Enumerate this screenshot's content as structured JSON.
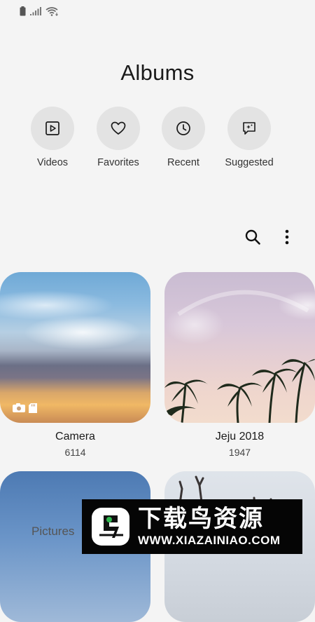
{
  "status_bar": {
    "icons": [
      "battery-icon",
      "signal-icon",
      "wifi-icon"
    ]
  },
  "header": {
    "title": "Albums"
  },
  "shortcuts": [
    {
      "label": "Videos",
      "icon": "video-icon"
    },
    {
      "label": "Favorites",
      "icon": "heart-icon"
    },
    {
      "label": "Recent",
      "icon": "clock-icon"
    },
    {
      "label": "Suggested",
      "icon": "sparkle-chat-icon"
    }
  ],
  "toolbar": {
    "icons": [
      "search-icon",
      "more-options-icon"
    ]
  },
  "albums": [
    {
      "name": "Camera",
      "count": "6114"
    },
    {
      "name": "Jeju 2018",
      "count": "1947"
    },
    {
      "name": "",
      "count": ""
    },
    {
      "name": "",
      "count": ""
    }
  ],
  "bottom_nav": {
    "pictures_label": "Pictures"
  },
  "watermark": {
    "title": "下载鸟资源",
    "url": "WWW.XIAZAINIAO.COM"
  },
  "colors": {
    "background": "#f4f4f4",
    "shortcut_circle": "#e3e3e3",
    "watermark_bg": "#050505"
  }
}
